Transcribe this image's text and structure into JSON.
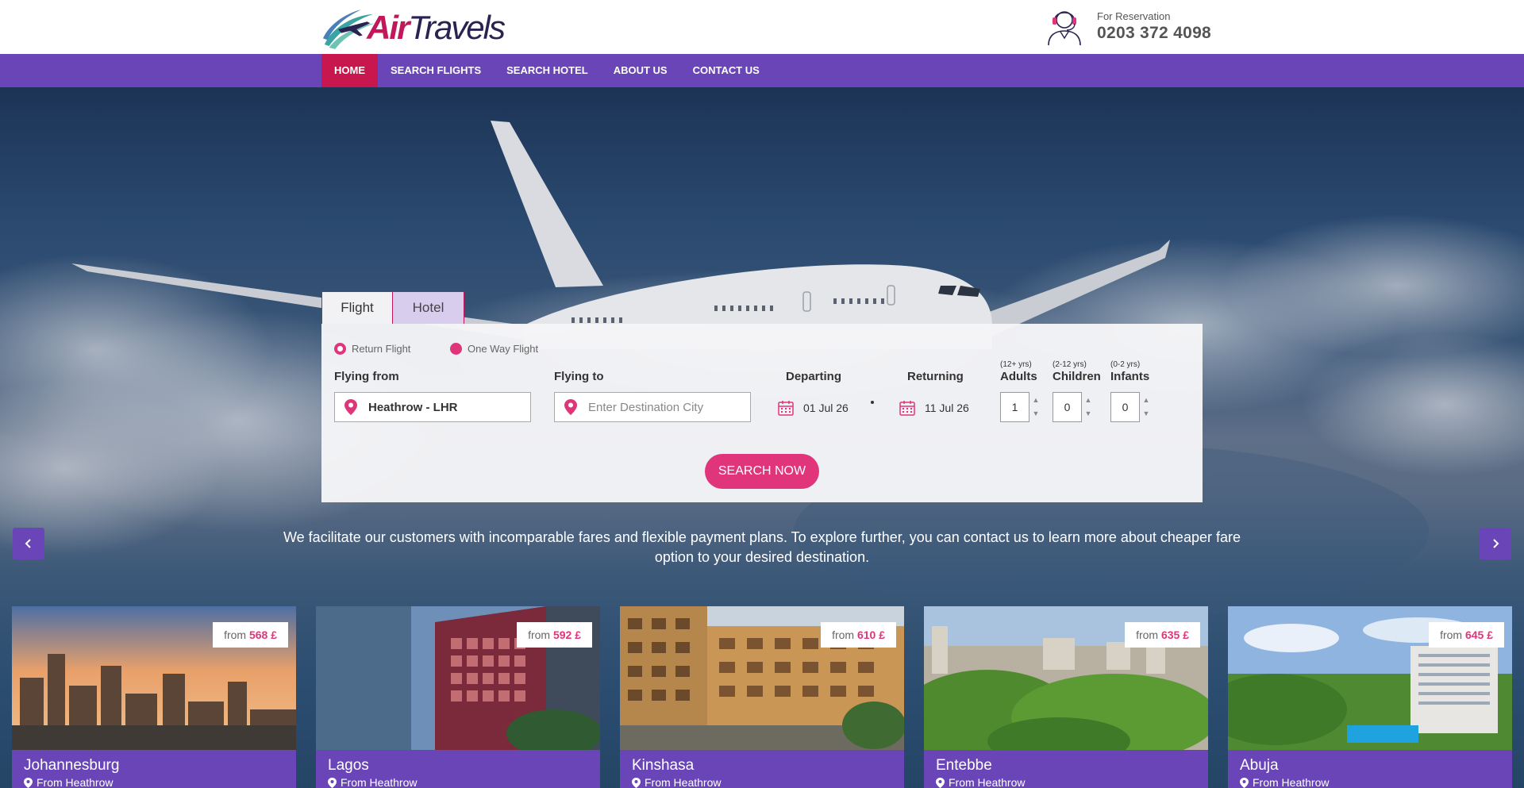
{
  "brand": {
    "name_part1": "Air",
    "name_part2": "Travels",
    "logo_icon": "airplane-swoosh-logo"
  },
  "reservation": {
    "label": "For Reservation",
    "phone": "0203 372 4098",
    "icon": "call-agent-icon"
  },
  "nav": {
    "items": [
      {
        "label": "HOME",
        "active": true
      },
      {
        "label": "SEARCH FLIGHTS",
        "active": false
      },
      {
        "label": "SEARCH HOTEL",
        "active": false
      },
      {
        "label": "ABOUT US",
        "active": false
      },
      {
        "label": "CONTACT US",
        "active": false
      }
    ]
  },
  "search": {
    "tabs": [
      {
        "label": "Flight",
        "active": true
      },
      {
        "label": "Hotel",
        "active": false
      }
    ],
    "trip_types": [
      {
        "label": "Return Flight",
        "selected": true
      },
      {
        "label": "One Way Flight",
        "selected": false
      }
    ],
    "from": {
      "label": "Flying from",
      "value": "Heathrow - LHR"
    },
    "to": {
      "label": "Flying to",
      "placeholder": "Enter Destination City",
      "value": ""
    },
    "departing": {
      "label": "Departing",
      "value": "01 Jul 26"
    },
    "returning": {
      "label": "Returning",
      "value": "11 Jul 26"
    },
    "adults": {
      "label": "Adults",
      "age": "(12+ yrs)",
      "value": "1"
    },
    "children": {
      "label": "Children",
      "age": "(2-12 yrs)",
      "value": "0"
    },
    "infants": {
      "label": "Infants",
      "age": "(0-2 yrs)",
      "value": "0"
    },
    "button": "SEARCH NOW"
  },
  "tagline": "We facilitate our customers with incomparable fares and flexible payment plans. To explore further, you can contact us to learn more about cheaper fare option to your desired destination.",
  "destinations": [
    {
      "city": "Johannesburg",
      "from_label": "From Heathrow",
      "price_prefix": "from",
      "price": "568 £"
    },
    {
      "city": "Lagos",
      "from_label": "From Heathrow",
      "price_prefix": "from",
      "price": "592 £"
    },
    {
      "city": "Kinshasa",
      "from_label": "From Heathrow",
      "price_prefix": "from",
      "price": "610 £"
    },
    {
      "city": "Entebbe",
      "from_label": "From Heathrow",
      "price_prefix": "from",
      "price": "635 £"
    },
    {
      "city": "Abuja",
      "from_label": "From Heathrow",
      "price_prefix": "from",
      "price": "645 £"
    }
  ],
  "colors": {
    "nav_bg": "#6a45b8",
    "active_nav": "#c8174f",
    "accent_pink": "#e0357a",
    "brand_magenta": "#c2185b",
    "brand_navy": "#2a2250"
  }
}
